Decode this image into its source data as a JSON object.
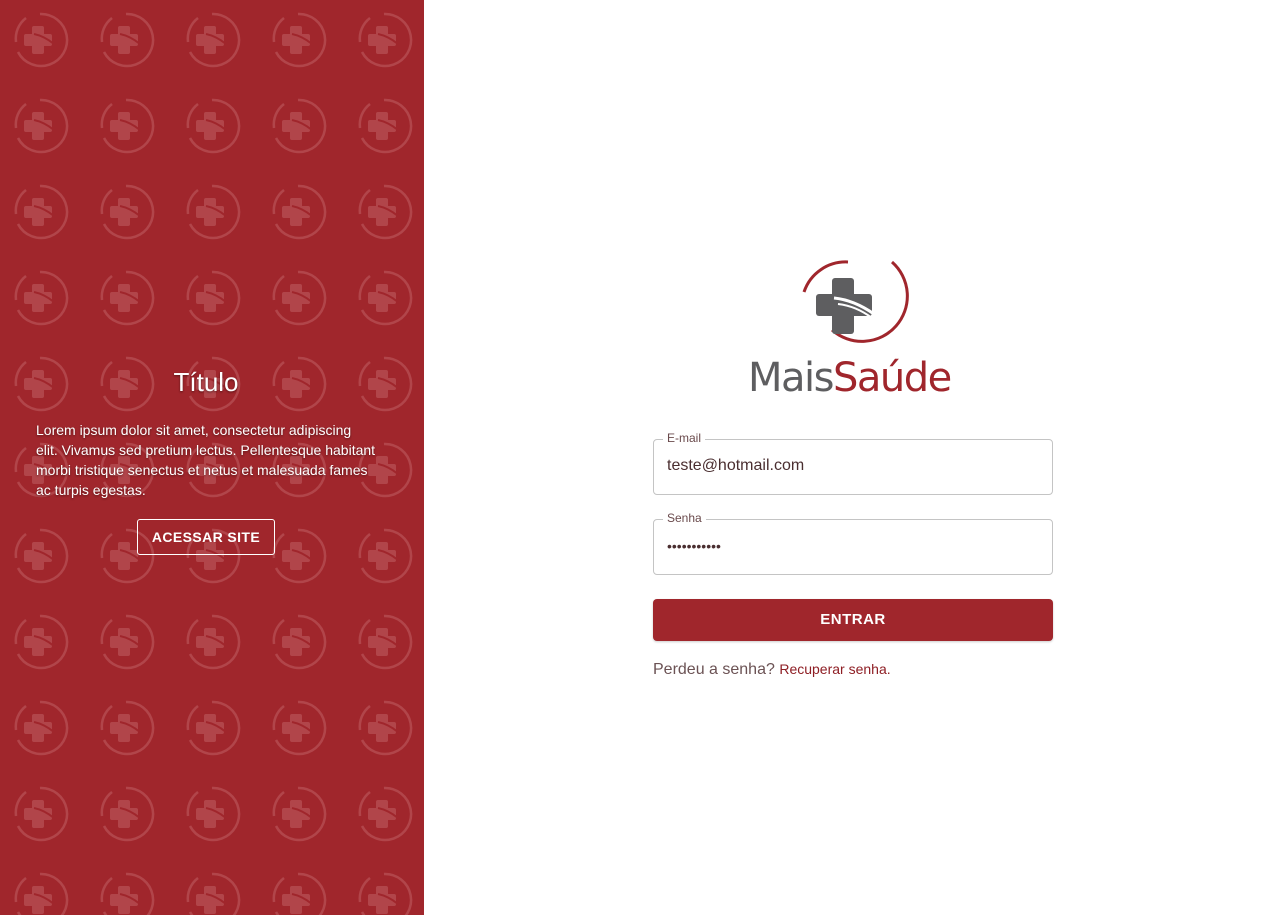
{
  "left_panel": {
    "title": "Título",
    "text": "Lorem ipsum dolor sit amet, consectetur adipiscing elit. Vivamus sed pretium lectus. Pellentesque habitant morbi tristique senectus et netus et malesuada fames ac turpis egestas.",
    "button_label": "ACESSAR SITE",
    "background_color": "#a0262c",
    "pattern_icon": "medical-cross-logo-icon"
  },
  "logo": {
    "text_part1": "Mais",
    "text_part2": "Saúde",
    "icon": "medical-cross-logo-icon",
    "colors": {
      "gray": "#5e5e60",
      "red": "#a0262c"
    }
  },
  "form": {
    "email": {
      "label": "E-mail",
      "value": "teste@hotmail.com"
    },
    "password": {
      "label": "Senha",
      "value": "•••••••••••"
    },
    "submit_label": "ENTRAR",
    "recover_prompt": "Perdeu a senha?",
    "recover_link": "Recuperar senha."
  }
}
